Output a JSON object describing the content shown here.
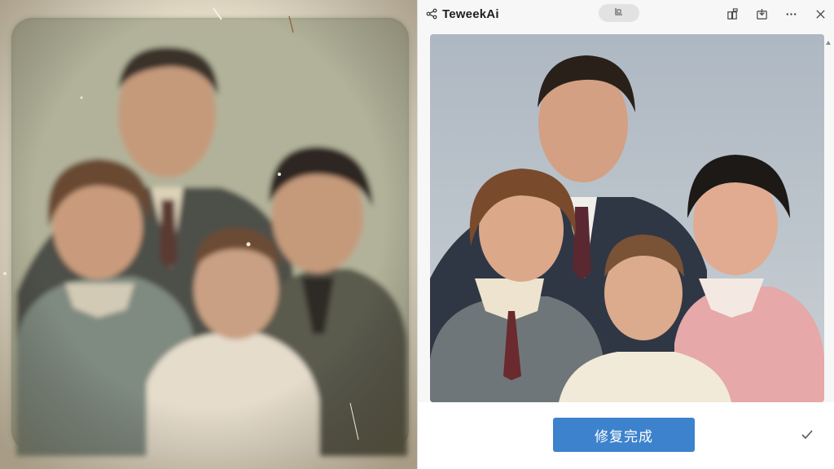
{
  "left_panel": {
    "image": "original-damaged-family-photo"
  },
  "app": {
    "title": "TeweekAi",
    "brand_icon": "share-icon",
    "center_control_icon": "tab-icon",
    "toolbar": {
      "icons": [
        "extensions-icon",
        "save-icon",
        "more-icon",
        "close-icon"
      ]
    },
    "image": "restored-family-photo",
    "done_button_label": "修复完成",
    "confirm_icon": "checkmark-icon"
  },
  "colors": {
    "accent": "#3d82cc",
    "window_bg": "#f7f7f7",
    "title_text": "#1f1f1f",
    "photo_backdrop": "#c2c9cf",
    "sepia_border": "#e6decb"
  }
}
